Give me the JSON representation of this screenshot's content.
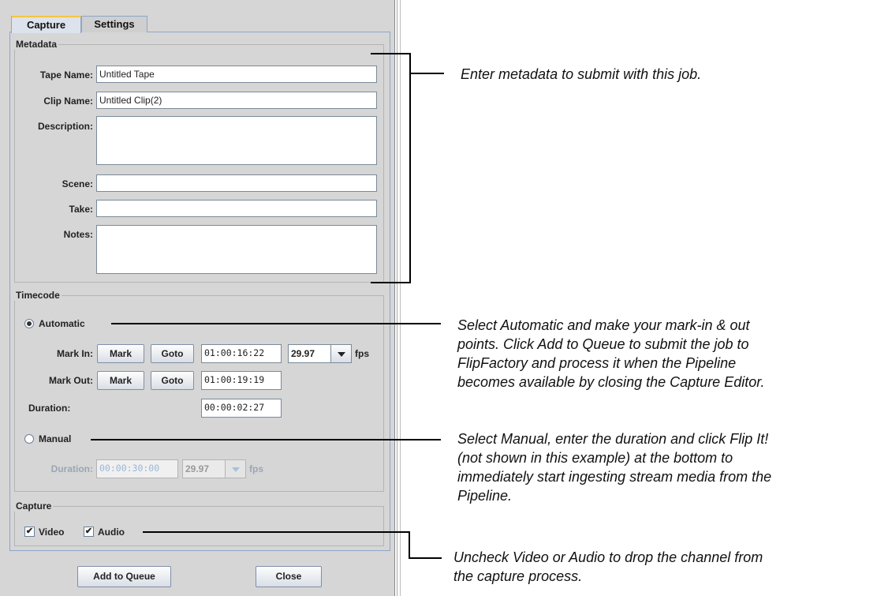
{
  "tabs": {
    "capture": "Capture",
    "settings": "Settings"
  },
  "metadata": {
    "title": "Metadata",
    "tape_name_label": "Tape Name:",
    "tape_name_value": "Untitled Tape",
    "clip_name_label": "Clip Name:",
    "clip_name_value": "Untitled Clip(2)",
    "description_label": "Description:",
    "description_value": "",
    "scene_label": "Scene:",
    "scene_value": "",
    "take_label": "Take:",
    "take_value": "",
    "notes_label": "Notes:",
    "notes_value": ""
  },
  "timecode": {
    "title": "Timecode",
    "automatic_label": "Automatic",
    "automatic_selected": true,
    "mark_in_label": "Mark In:",
    "mark_out_label": "Mark Out:",
    "mark_button": "Mark",
    "goto_button": "Goto",
    "mark_in_value": "01:00:16:22",
    "mark_out_value": "01:00:19:19",
    "fps_value": "29.97",
    "fps_label": "fps",
    "duration_label": "Duration:",
    "duration_value": "00:00:02:27",
    "manual_label": "Manual",
    "manual_selected": false,
    "manual_duration_label": "Duration:",
    "manual_duration_value": "00:00:30:00",
    "manual_fps_value": "29.97",
    "manual_fps_label": "fps"
  },
  "capture": {
    "title": "Capture",
    "video_label": "Video",
    "video_checked": true,
    "audio_label": "Audio",
    "audio_checked": true
  },
  "buttons": {
    "add_to_queue": "Add to Queue",
    "close": "Close"
  },
  "annotations": {
    "metadata": "Enter metadata to submit with this job.",
    "automatic": [
      "Select Automatic and make your mark-in & out",
      "points. Click Add to Queue to submit the job to",
      "FlipFactory and process it when the Pipeline",
      "becomes available by closing the Capture Editor."
    ],
    "manual": [
      "Select Manual, enter the duration and click Flip It!",
      "(not shown in this example) at the bottom to",
      "immediately start ingesting stream media from the",
      "Pipeline."
    ],
    "capture": [
      "Uncheck Video or Audio to drop the channel from",
      "the capture process."
    ]
  },
  "colors": {
    "panel_bg": "#d6d6d6",
    "tab_accent": "#f4c542",
    "border_blue": "#8ea6c8"
  }
}
